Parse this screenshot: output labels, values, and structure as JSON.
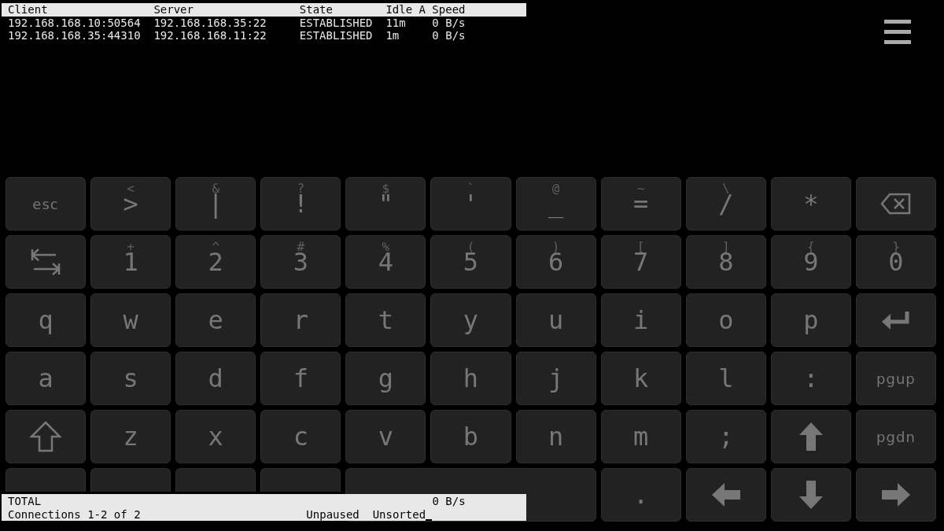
{
  "connections": {
    "columns": [
      "Client",
      "Server",
      "State",
      "Idle A",
      "Speed"
    ],
    "rows": [
      [
        "192.168.168.10:50564",
        "192.168.168.35:22",
        "ESTABLISHED",
        "11m",
        "0 B/s"
      ],
      [
        "192.168.168.35:44310",
        "192.168.168.11:22",
        "ESTABLISHED",
        "1m",
        "0 B/s"
      ]
    ]
  },
  "keyboard": {
    "rows": [
      [
        {
          "kind": "word",
          "label": "esc"
        },
        {
          "kind": "char",
          "label": ">",
          "secondary": "<"
        },
        {
          "kind": "char",
          "label": "|",
          "secondary": "&"
        },
        {
          "kind": "char",
          "label": "!",
          "secondary": "?"
        },
        {
          "kind": "char",
          "label": "\"",
          "secondary": "$"
        },
        {
          "kind": "char",
          "label": "'",
          "secondary": "`"
        },
        {
          "kind": "char",
          "label": "_",
          "secondary": "@"
        },
        {
          "kind": "char",
          "label": "=",
          "secondary": "~"
        },
        {
          "kind": "char",
          "label": "/",
          "secondary": "\\"
        },
        {
          "kind": "char",
          "label": "*"
        },
        {
          "kind": "backspace"
        }
      ],
      [
        {
          "kind": "tab"
        },
        {
          "kind": "char",
          "label": "1",
          "secondary": "+"
        },
        {
          "kind": "char",
          "label": "2",
          "secondary": "^"
        },
        {
          "kind": "char",
          "label": "3",
          "secondary": "#"
        },
        {
          "kind": "char",
          "label": "4",
          "secondary": "%"
        },
        {
          "kind": "char",
          "label": "5",
          "secondary": "("
        },
        {
          "kind": "char",
          "label": "6",
          "secondary": ")"
        },
        {
          "kind": "char",
          "label": "7",
          "secondary": "["
        },
        {
          "kind": "char",
          "label": "8",
          "secondary": "]"
        },
        {
          "kind": "char",
          "label": "9",
          "secondary": "{"
        },
        {
          "kind": "char",
          "label": "0",
          "secondary": "}"
        }
      ],
      [
        {
          "kind": "char",
          "label": "q"
        },
        {
          "kind": "char",
          "label": "w"
        },
        {
          "kind": "char",
          "label": "e"
        },
        {
          "kind": "char",
          "label": "r"
        },
        {
          "kind": "char",
          "label": "t"
        },
        {
          "kind": "char",
          "label": "y"
        },
        {
          "kind": "char",
          "label": "u"
        },
        {
          "kind": "char",
          "label": "i"
        },
        {
          "kind": "char",
          "label": "o"
        },
        {
          "kind": "char",
          "label": "p"
        },
        {
          "kind": "enter"
        }
      ],
      [
        {
          "kind": "char",
          "label": "a"
        },
        {
          "kind": "char",
          "label": "s"
        },
        {
          "kind": "char",
          "label": "d"
        },
        {
          "kind": "char",
          "label": "f"
        },
        {
          "kind": "char",
          "label": "g"
        },
        {
          "kind": "char",
          "label": "h"
        },
        {
          "kind": "char",
          "label": "j"
        },
        {
          "kind": "char",
          "label": "k"
        },
        {
          "kind": "char",
          "label": "l"
        },
        {
          "kind": "char",
          "label": ":"
        },
        {
          "kind": "word",
          "label": "pgup"
        }
      ],
      [
        {
          "kind": "shift"
        },
        {
          "kind": "char",
          "label": "z"
        },
        {
          "kind": "char",
          "label": "x"
        },
        {
          "kind": "char",
          "label": "c"
        },
        {
          "kind": "char",
          "label": "v"
        },
        {
          "kind": "char",
          "label": "b"
        },
        {
          "kind": "char",
          "label": "n"
        },
        {
          "kind": "char",
          "label": "m"
        },
        {
          "kind": "char",
          "label": ";"
        },
        {
          "kind": "arrow-up"
        },
        {
          "kind": "word",
          "label": "pgdn"
        }
      ]
    ],
    "bottom_keys": [
      {
        "kind": "blank"
      },
      {
        "kind": "blank"
      },
      {
        "kind": "blank"
      },
      {
        "kind": "blank"
      },
      {
        "kind": "space"
      },
      {
        "kind": "char",
        "label": "."
      },
      {
        "kind": "arrow-left"
      },
      {
        "kind": "arrow-down"
      },
      {
        "kind": "arrow-right"
      }
    ]
  },
  "status_bar": {
    "total_label": "TOTAL",
    "total_speed": "0 B/s",
    "connections": "Connections 1-2 of 2",
    "pause_state": "Unpaused",
    "sort_state": "Unsorted"
  }
}
